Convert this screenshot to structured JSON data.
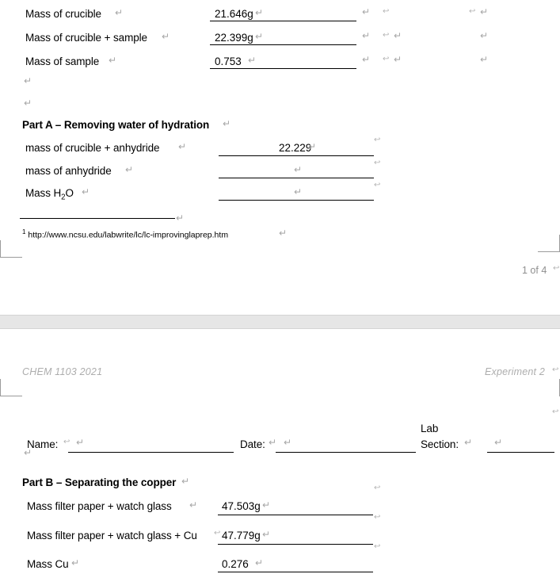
{
  "document": {
    "page_one": {
      "measurement_rows": [
        {
          "label": "Mass of crucible",
          "value": "21.646g"
        },
        {
          "label": "Mass of crucible + sample",
          "value": "22.399g"
        },
        {
          "label": "Mass of sample",
          "value": "0.753"
        }
      ],
      "part_a": {
        "heading": "Part A – Removing water of hydration",
        "rows": [
          {
            "label": "mass of crucible + anhydride",
            "value": "22.229"
          },
          {
            "label": "mass of anhydride",
            "value": ""
          },
          {
            "label": "Mass H2O",
            "value": ""
          }
        ]
      },
      "footnote": {
        "marker": "1",
        "text": "http://www.ncsu.edu/labwrite/lc/lc-improvinglaprep.htm"
      },
      "page_number": "1 of 4"
    },
    "page_two": {
      "header": {
        "left": "CHEM 1103   2021",
        "right": "Experiment 2"
      },
      "info_fields": [
        {
          "label": "Name:",
          "value": ""
        },
        {
          "label": "Date:",
          "value": ""
        },
        {
          "label": "Lab Section:",
          "value": ""
        }
      ],
      "part_b": {
        "heading": "Part B – Separating the copper",
        "rows": [
          {
            "label": "Mass filter paper + watch glass",
            "value": "47.503g"
          },
          {
            "label": "Mass filter paper + watch glass + Cu",
            "value": "47.779g"
          },
          {
            "label": "Mass Cu",
            "value": "0.276"
          }
        ]
      }
    }
  },
  "marks": {
    "paragraph": "↵",
    "line_break": "↩"
  },
  "colors": {
    "page_background": "#ffffff",
    "page_gap": "#e6e6e6",
    "mark_gray": "#a6a6a6",
    "header_gray": "#adadad",
    "rule_black": "#000000"
  }
}
